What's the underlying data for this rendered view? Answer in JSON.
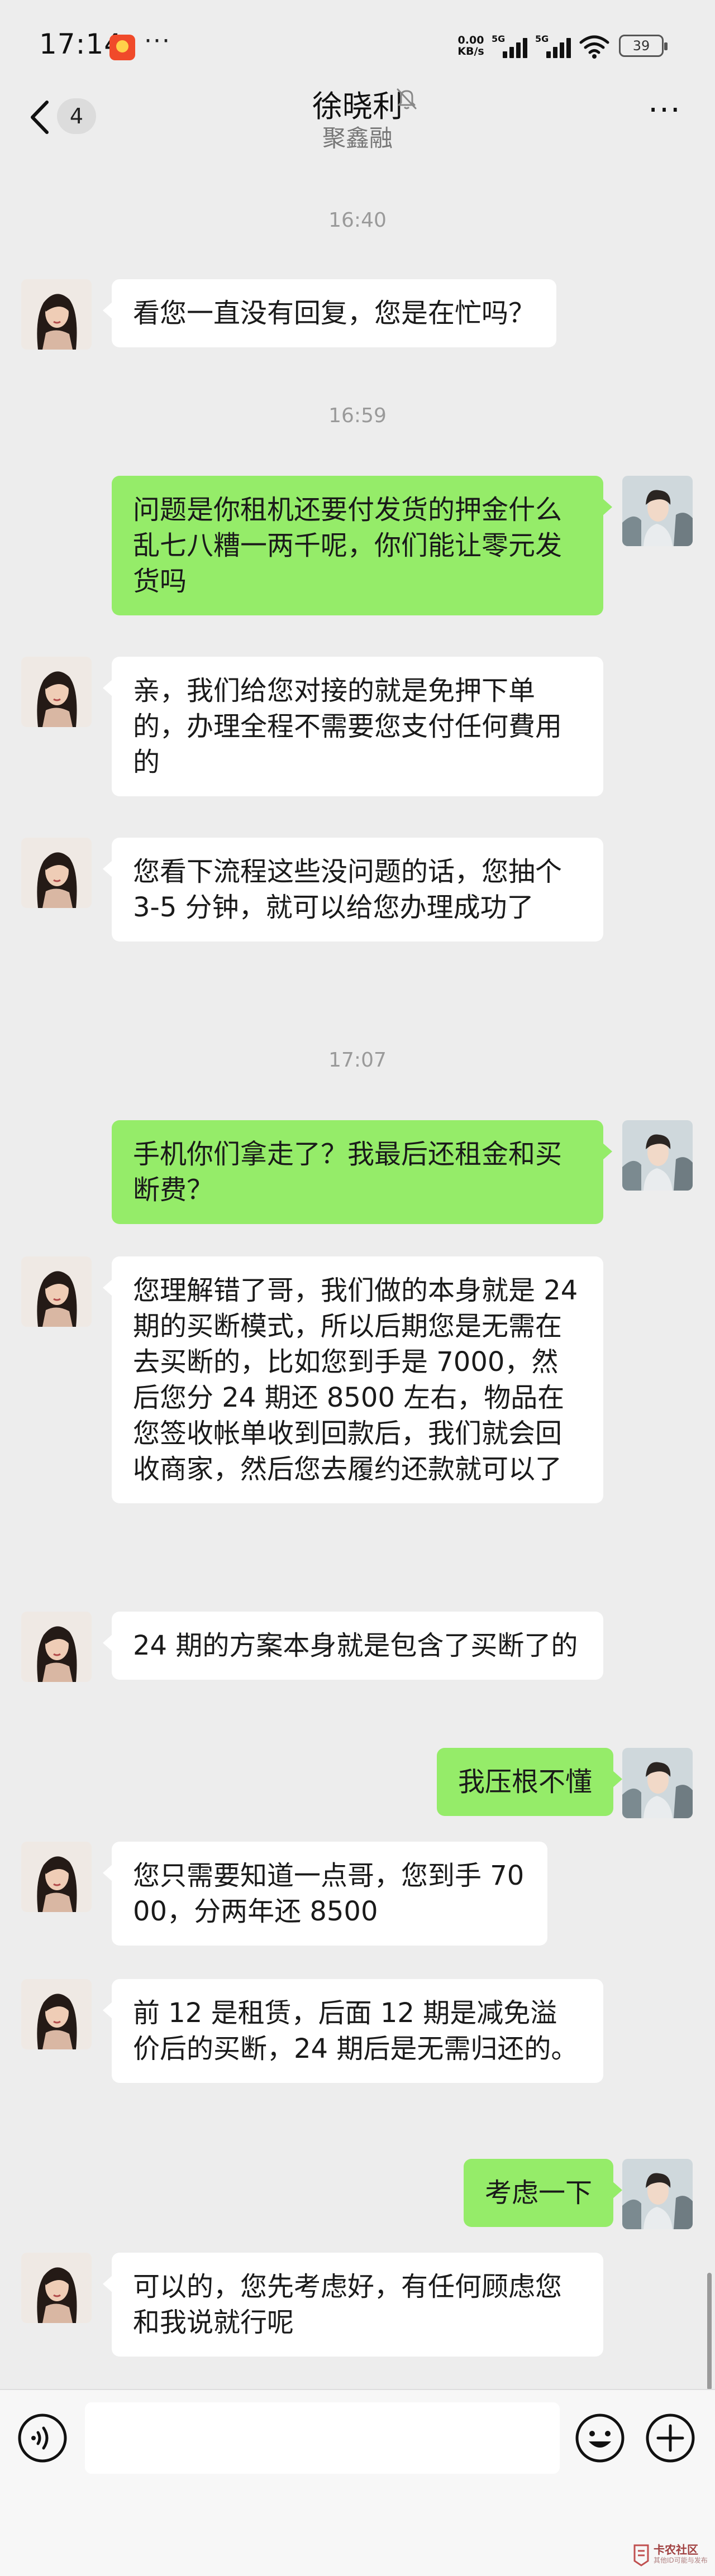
{
  "status_bar": {
    "time": "17:14",
    "net_speed_value": "0.00",
    "net_speed_unit": "KB/s",
    "sim1_label": "5G",
    "sim2_label": "5G",
    "battery": "39"
  },
  "header": {
    "unread_count": "4",
    "contact_name": "徐晓利",
    "contact_subtitle": "聚鑫融",
    "more_label": "···"
  },
  "messages": [
    {
      "type": "time",
      "text": "16:40"
    },
    {
      "type": "in",
      "text": "看您一直没有回复，您是在忙吗？"
    },
    {
      "type": "time",
      "text": "16:59"
    },
    {
      "type": "out",
      "text": "问题是你租机还要付发货的押金什么乱七八糟一两千呢，你们能让零元发货吗"
    },
    {
      "type": "in",
      "text": "亲，我们给您对接的就是免押下单的，办理全程不需要您支付任何費用的"
    },
    {
      "type": "in",
      "text": "您看下流程这些没问题的话，您抽个 3-5 分钟，就可以给您办理成功了"
    },
    {
      "type": "time",
      "text": "17:07"
    },
    {
      "type": "out",
      "text": "手机你们拿走了？我最后还租金和买断费？"
    },
    {
      "type": "in",
      "text": "您理解错了哥，我们做的本身就是 24 期的买断模式，所以后期您是无需在去买断的，比如您到手是 7000，然后您分 24 期还 8500 左右，物品在您签收帐单收到回款后，我们就会回收商家，然后您去履约还款就可以了"
    },
    {
      "type": "in",
      "text": "24 期的方案本身就是包含了买断了的"
    },
    {
      "type": "out",
      "text": "我压根不懂"
    },
    {
      "type": "in",
      "text": "您只需要知道一点哥，您到手 7000，分两年还 8500"
    },
    {
      "type": "in",
      "text": "前 12 是租赁，后面 12 期是减免溢价后的买断，24 期后是无需归还的。"
    },
    {
      "type": "out",
      "text": "考虑一下"
    },
    {
      "type": "in",
      "text": "可以的，您先考虑好，有任何顾虑您和我说就行呢"
    }
  ],
  "input_bar": {
    "placeholder": ""
  },
  "watermark": {
    "title": "卡农社区",
    "subtitle": "其他ID可能与发布"
  },
  "colors": {
    "background": "#ededed",
    "outgoing_bubble": "#95ec69",
    "incoming_bubble": "#ffffff",
    "timestamp": "#9a9a9a"
  }
}
